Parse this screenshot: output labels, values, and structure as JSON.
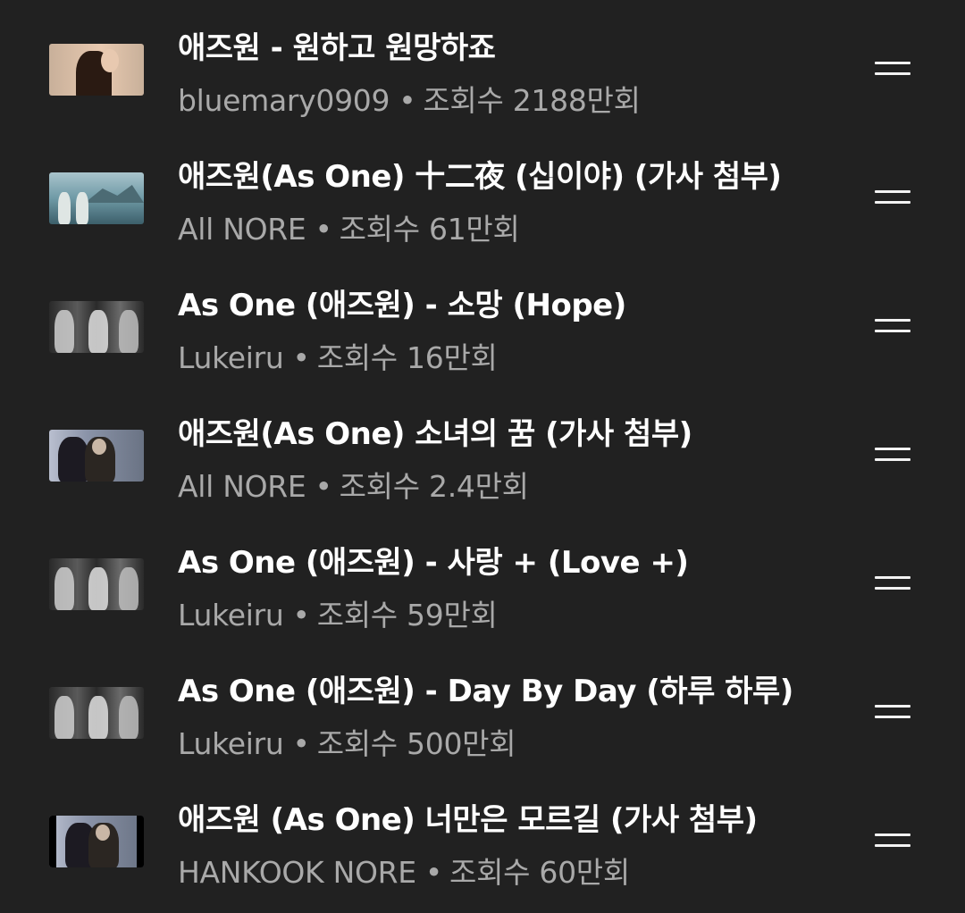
{
  "playlist": {
    "items": [
      {
        "title": "애즈원 - 원하고 원망하죠",
        "channel": "bluemary0909",
        "separator": "•",
        "views": "조회수 2188만회",
        "thumb": {
          "bg": "#c8b09a",
          "fig": "#2a1a12",
          "accent": "#e8c9b0",
          "style": "portrait"
        }
      },
      {
        "title": "애즈원(As One)  十二夜 (십이야) (가사 첨부)",
        "channel": "All NORE",
        "separator": "•",
        "views": "조회수 61만회",
        "thumb": {
          "bg": "#6f9aa6",
          "fig": "#dfe6e4",
          "accent": "#3c5f6a",
          "style": "landscape"
        }
      },
      {
        "title": "As One (애즈원) - 소망 (Hope)",
        "channel": "Lukeiru",
        "separator": "•",
        "views": "조회수 16만회",
        "thumb": {
          "bg": "#3a3a3a",
          "fig": "#d9d9d9",
          "accent": "#7a7a7a",
          "style": "mono"
        }
      },
      {
        "title": "애즈원(As One) 소녀의 꿈 (가사 첨부)",
        "channel": "All NORE",
        "separator": "•",
        "views": "조회수 2.4만회",
        "thumb": {
          "bg": "#8a93a8",
          "fig": "#1c1a22",
          "accent": "#c9b7a6",
          "style": "street"
        }
      },
      {
        "title": "As One (애즈원) - 사랑 + (Love +)",
        "channel": "Lukeiru",
        "separator": "•",
        "views": "조회수 59만회",
        "thumb": {
          "bg": "#3a3a3a",
          "fig": "#d9d9d9",
          "accent": "#7a7a7a",
          "style": "mono"
        }
      },
      {
        "title": "As One (애즈원) - Day By Day (하루 하루)",
        "channel": "Lukeiru",
        "separator": "•",
        "views": "조회수 500만회",
        "thumb": {
          "bg": "#3a3a3a",
          "fig": "#d9d9d9",
          "accent": "#7a7a7a",
          "style": "mono"
        }
      },
      {
        "title": "애즈원 (As One) 너만은 모르길 (가사 첨부)",
        "channel": "HANKOOK NORE",
        "separator": "•",
        "views": "조회수 60만회",
        "thumb": {
          "bg": "#8a93a8",
          "fig": "#1c1a22",
          "accent": "#c9b7a6",
          "style": "street-letterbox"
        }
      }
    ],
    "drag_handle_icon": "drag-handle-icon"
  }
}
